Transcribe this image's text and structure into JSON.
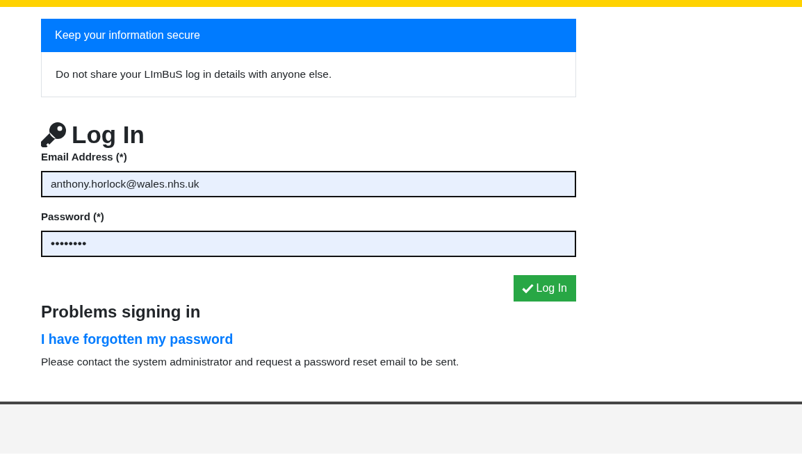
{
  "notice": {
    "title": "Keep your information secure",
    "message": "Do not share your LImBuS log in details with anyone else."
  },
  "login": {
    "heading": "Log In",
    "fields": [
      {
        "kind": "email",
        "label": "Email Address (*)",
        "value": "anthony.horlock@wales.nhs.uk"
      },
      {
        "kind": "password",
        "label": "Password (*)",
        "value": "••••••••"
      }
    ],
    "submit": "Log In"
  },
  "help": {
    "heading": "Problems signing in",
    "link": "I have forgotten my password",
    "text": "Please contact the system administrator and request a password reset email to be sent."
  }
}
